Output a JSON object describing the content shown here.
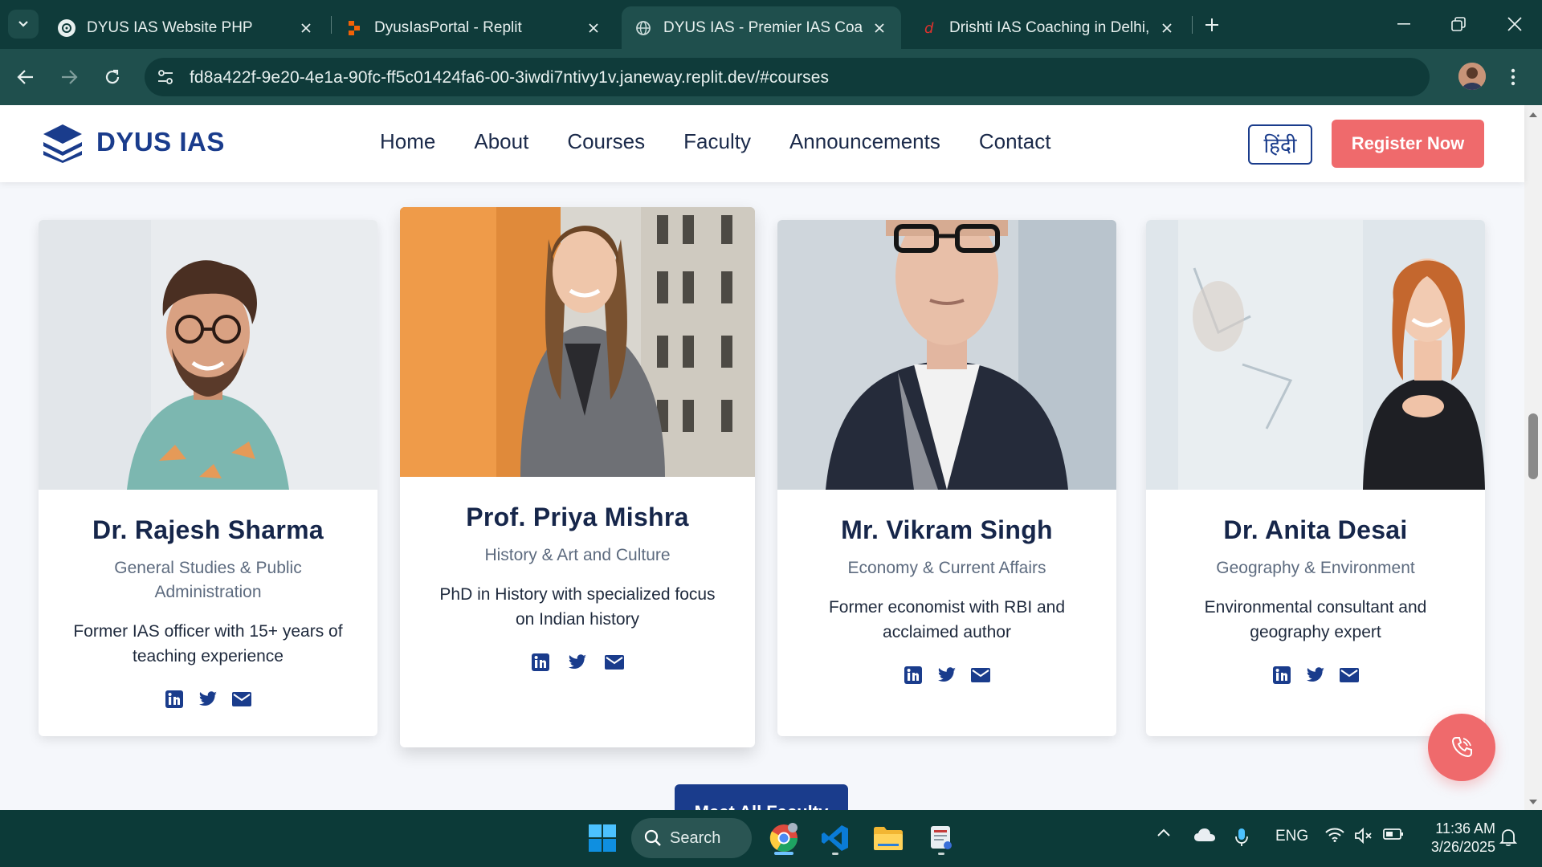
{
  "browser": {
    "tabs": [
      {
        "title": "DYUS IAS Website PHP",
        "active": false
      },
      {
        "title": "DyusIasPortal - Replit",
        "active": false
      },
      {
        "title": "DYUS IAS - Premier IAS Coaching",
        "active": true
      },
      {
        "title": "Drishti IAS Coaching in Delhi, Best",
        "active": false
      }
    ],
    "url": "fd8a422f-9e20-4e1a-90fc-ff5c01424fa6-00-3iwdi7ntivy1v.janeway.replit.dev/#courses"
  },
  "site": {
    "logo_text": "DYUS IAS",
    "nav": [
      "Home",
      "About",
      "Courses",
      "Faculty",
      "Announcements",
      "Contact"
    ],
    "lang_button": "हिंदी",
    "register_button": "Register Now"
  },
  "faculty": [
    {
      "name": "Dr. Rajesh Sharma",
      "subject": "General Studies & Public Administration",
      "bio": "Former IAS officer with 15+ years of teaching experience"
    },
    {
      "name": "Prof. Priya Mishra",
      "subject": "History & Art and Culture",
      "bio": "PhD in History with specialized focus on Indian history"
    },
    {
      "name": "Mr. Vikram Singh",
      "subject": "Economy & Current Affairs",
      "bio": "Former economist with RBI and acclaimed author"
    },
    {
      "name": "Dr. Anita Desai",
      "subject": "Geography & Environment",
      "bio": "Environmental consultant and geography expert"
    }
  ],
  "meet_all_button": "Meet All Faculty",
  "taskbar": {
    "search_label": "Search",
    "language": "ENG",
    "time": "11:36 AM",
    "date": "3/26/2025"
  },
  "colors": {
    "brand_navy": "#1a3c8c",
    "accent_coral": "#ef6a6c",
    "chrome_teal": "#1f4f4d"
  }
}
